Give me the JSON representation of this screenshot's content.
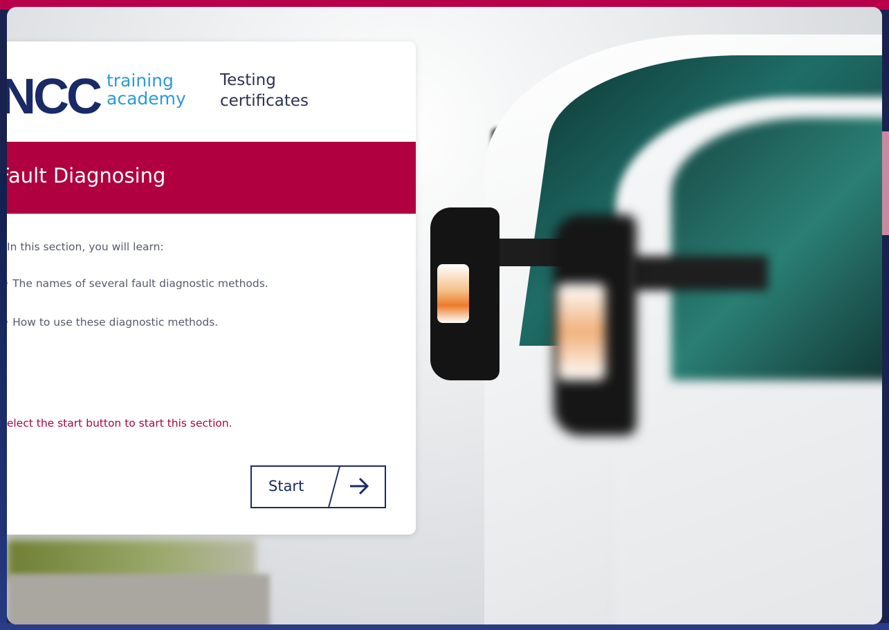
{
  "logo": {
    "brand": "NCC",
    "line1": "training",
    "line2": "academy",
    "product_line1": "Testing",
    "product_line2": "certificates"
  },
  "section": {
    "title": "Fault Diagnosing"
  },
  "content": {
    "intro": "In this section, you will learn:",
    "bullets": [
      "The names of several fault diagnostic methods.",
      "How to use these diagnostic methods."
    ],
    "instruction": "Select the start button to start this section."
  },
  "actions": {
    "start_label": "Start",
    "start_icon": "arrow-right-icon"
  },
  "colors": {
    "accent": "#b0003f",
    "navy": "#1a2a66",
    "logo_blue": "#2a9ad8"
  }
}
